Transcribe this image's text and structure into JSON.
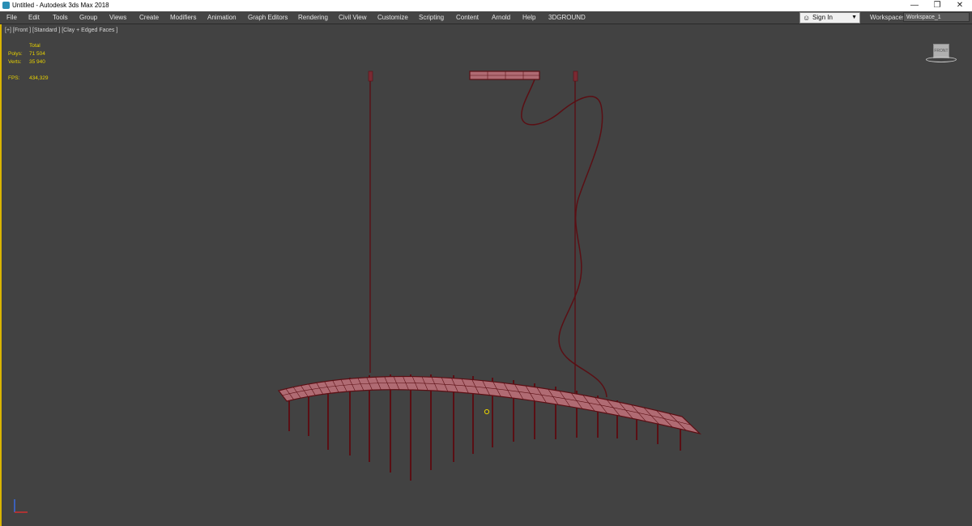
{
  "window": {
    "title": "Untitled - Autodesk 3ds Max 2018",
    "app_icon": "3ds-max-icon",
    "controls": {
      "minimize": "—",
      "restore": "❐",
      "close": "✕"
    }
  },
  "menu": {
    "items": [
      "File",
      "Edit",
      "Tools",
      "Group",
      "Views",
      "Create",
      "Modifiers",
      "Animation",
      "Graph Editors",
      "Rendering",
      "Civil View",
      "Customize",
      "Scripting",
      "Content",
      "Arnold",
      "Help",
      "3DGROUND"
    ],
    "sign_in": "Sign In",
    "workspaces_label": "Workspaces:",
    "workspace_value": "Workspace_1"
  },
  "viewport": {
    "label": "[+] [Front ] [Standard ] [Clay + Edged Faces ]",
    "stats": {
      "header": "Total",
      "polys_label": "Polys:",
      "polys_value": "71 504",
      "verts_label": "Verts:",
      "verts_value": "35 940",
      "fps_label": "FPS:",
      "fps_value": "434,329"
    },
    "viewcube_label": "FRONT",
    "colors": {
      "background": "#424242",
      "model_fill": "#b06b73",
      "wire": "#5a0f14",
      "stats_text": "#e8d200",
      "active_border": "#d9b400"
    }
  }
}
